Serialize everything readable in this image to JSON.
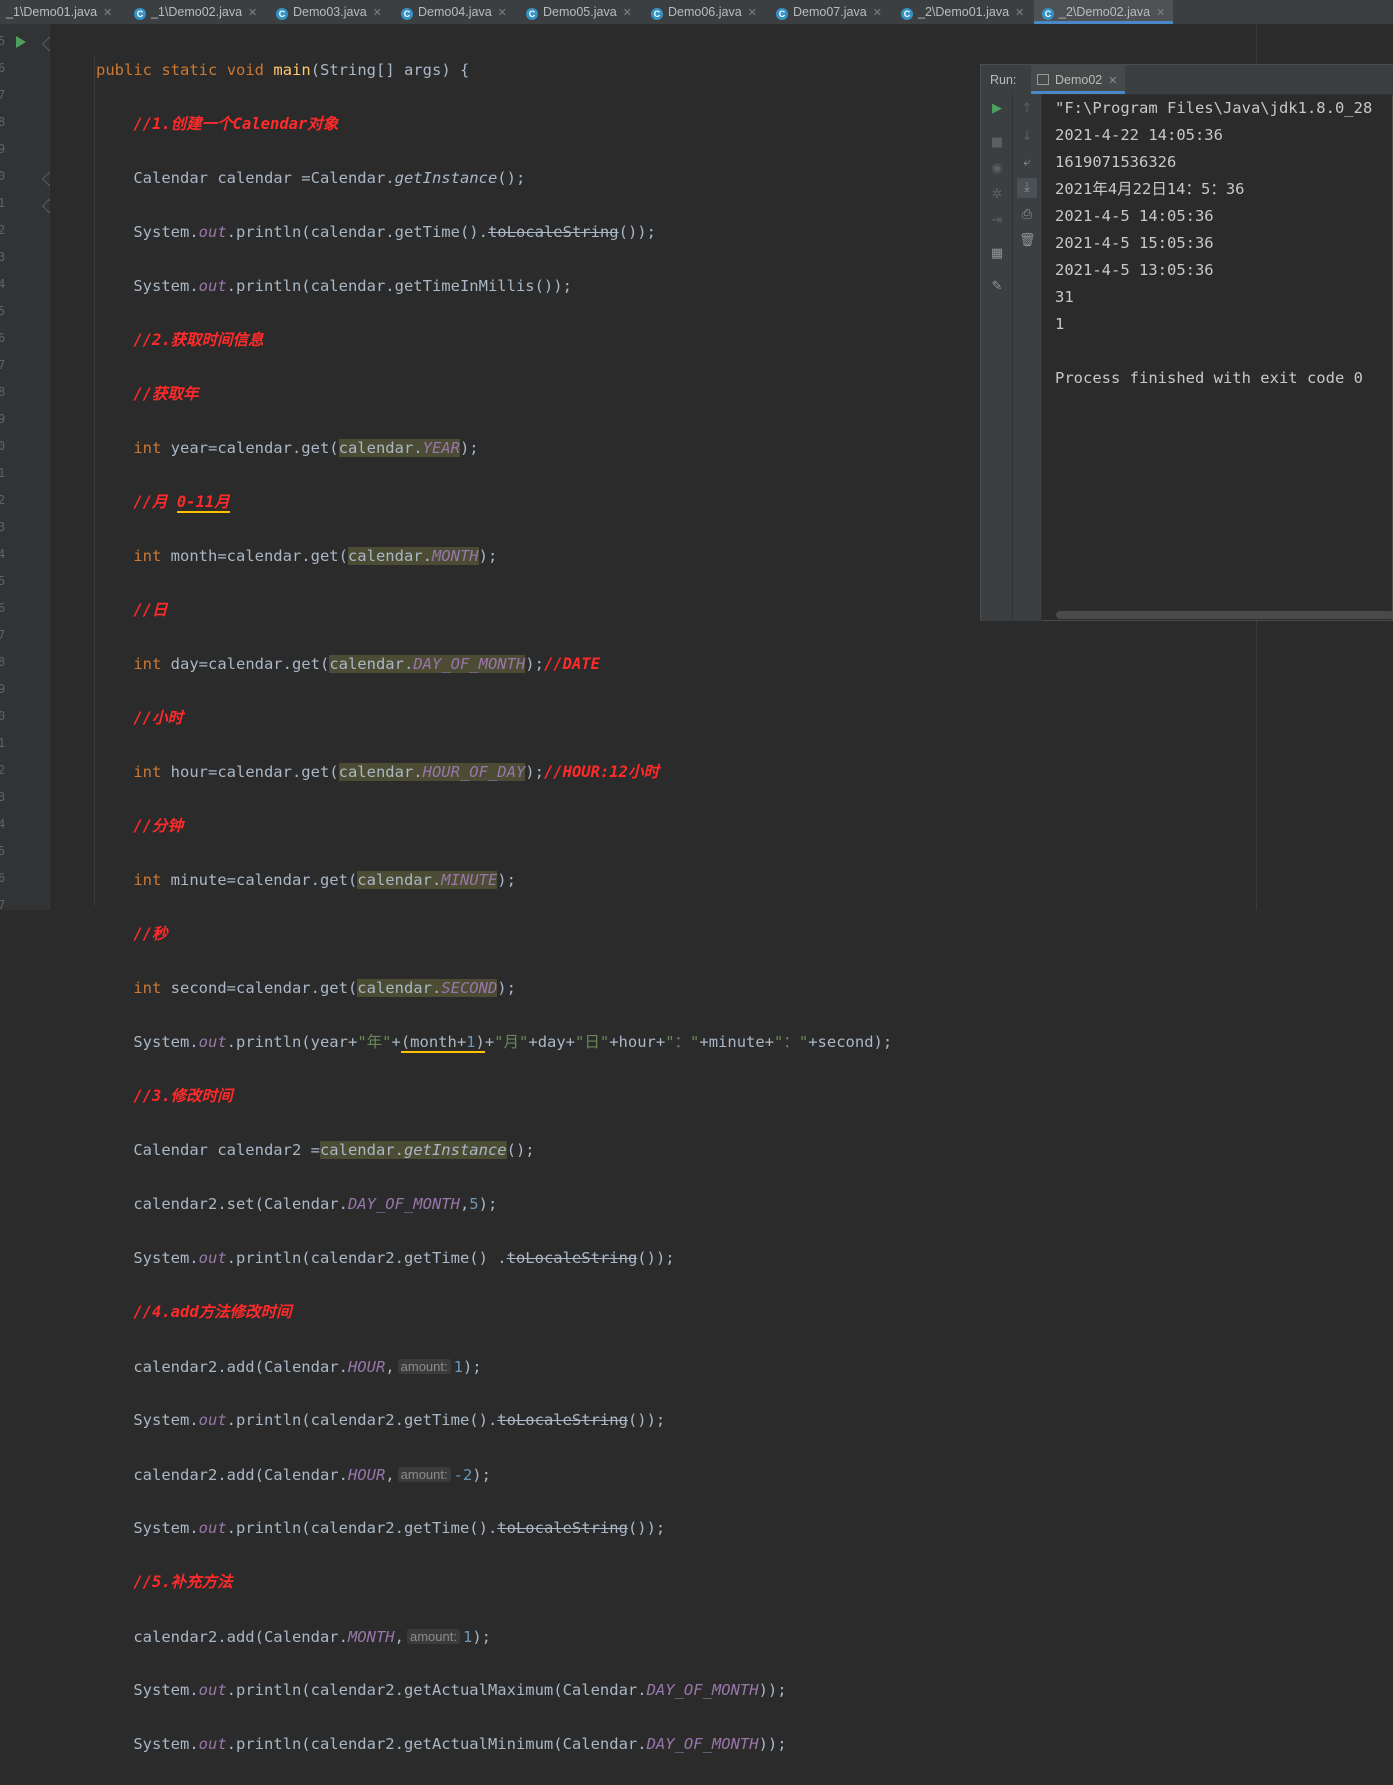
{
  "tabs": [
    {
      "label": "_1\\Demo01.java",
      "active": false
    },
    {
      "label": "_1\\Demo02.java",
      "active": false
    },
    {
      "label": "Demo03.java",
      "active": false
    },
    {
      "label": "Demo04.java",
      "active": false
    },
    {
      "label": "Demo05.java",
      "active": false
    },
    {
      "label": "Demo06.java",
      "active": false
    },
    {
      "label": "Demo07.java",
      "active": false
    },
    {
      "label": "_2\\Demo01.java",
      "active": false
    },
    {
      "label": "_2\\Demo02.java",
      "active": true
    }
  ],
  "gutter_numbers": [
    "5",
    "6",
    "7",
    "8",
    "9",
    "0",
    "1",
    "2",
    "3",
    "4",
    "5",
    "6",
    "7",
    "8",
    "9",
    "0",
    "1",
    "2",
    "3",
    "4",
    "5",
    "6",
    "7",
    "8",
    "9",
    "0",
    "1",
    "2",
    "3",
    "4",
    "5",
    "6",
    "7"
  ],
  "code": {
    "l1_public": "public",
    "l1_static": "static",
    "l1_void": "void",
    "l1_main": "main",
    "l1_rest": "(String[] args) {",
    "c1": "//1.创建一个Calendar对象",
    "l3_a": "Calendar calendar =Calendar.",
    "l3_fn": "getInstance",
    "l3_b": "();",
    "sys": "System.",
    "out": "out",
    "l4_a": ".println(calendar.getTime().",
    "toLocaleString": "toLocaleString",
    "l4_b": "());",
    "l5_a": ".println(calendar.getTimeInMillis());",
    "c2": "//2.获取时间信息",
    "c3": "//获取年",
    "int": "int",
    "l8_a": " year=calendar.get(",
    "calendar_dot": "calendar.",
    "YEAR": "YEAR",
    "close": ");",
    "c4a": "//月 ",
    "c4b": "0-11月",
    "l10_a": " month=calendar.get(",
    "MONTH": "MONTH",
    "c5": "//日",
    "l12_a": " day=calendar.get(",
    "DAY_OF_MONTH": "DAY_OF_MONTH",
    "close_nosemi": ");",
    "c_date": "//DATE",
    "c6": "//小时",
    "l14_a": " hour=calendar.get(",
    "HOUR_OF_DAY": "HOUR_OF_DAY",
    "c_hour": "//HOUR:12小时",
    "c7": "//分钟",
    "l16_a": " minute=calendar.get(",
    "MINUTE": "MINUTE",
    "c8": "//秒",
    "l18_a": " second=calendar.get(",
    "SECOND": "SECOND",
    "l19_a": ".println(year+",
    "s_year": "\"年\"",
    "plus": "+",
    "month_expr_a": "(month+",
    "one": "1",
    "month_expr_b": ")",
    "s_month": "\"月\"",
    "l19_mid1": "+day+",
    "s_day": "\"日\"",
    "l19_mid2": "+hour+",
    "s_colon": "\"：\"",
    "l19_mid3": "+minute+",
    "l19_end": "+second);",
    "c9": "//3.修改时间",
    "l21_a": "Calendar calendar2 =",
    "calendar_getInstance_a": "calendar.",
    "getInstance": "getInstance",
    "l21_b": "();",
    "l22_a": "calendar2.set(Calendar.",
    "l22_b": ",",
    "five": "5",
    "l23_a": ".println(calendar2.getTime() .",
    "l23_b": "());",
    "c10": "//4.add方法修改时间",
    "l25_a": "calendar2.add(Calendar.",
    "HOUR": "HOUR",
    "comma": ",",
    "amount_hint": "amount:",
    "neg_two": "-2",
    "l26_a": ".println(calendar2.getTime().",
    "c11": "//5.补充方法",
    "l30_a": ".println(calendar2.getActualMaximum(Calendar.",
    "l31_a": ".println(calendar2.getActualMinimum(Calendar.",
    "close_dbl": "));"
  },
  "run_panel": {
    "label": "Run:",
    "tab": "Demo02",
    "output": [
      "\"F:\\Program Files\\Java\\jdk1.8.0_28",
      "2021-4-22 14:05:36",
      "1619071536326",
      "2021年4月22日14：5：36",
      "2021-4-5 14:05:36",
      "2021-4-5 15:05:36",
      "2021-4-5 13:05:36",
      "31",
      "1",
      "",
      "Process finished with exit code 0"
    ],
    "icons": [
      "run-icon",
      "stop-icon",
      "camera-icon",
      "debug-icon",
      "login-icon",
      "layout-icon",
      "pin-icon",
      "up-arrow-icon",
      "down-arrow-icon",
      "soft-wrap-icon",
      "scroll-to-end-icon",
      "print-icon",
      "trash-icon"
    ]
  }
}
